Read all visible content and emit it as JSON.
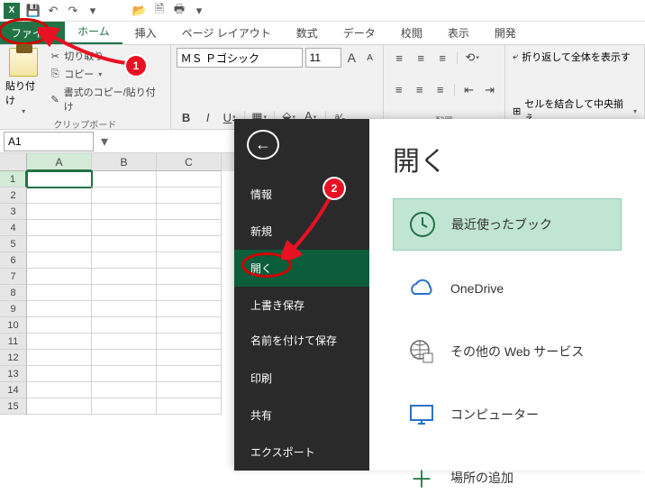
{
  "qat": {
    "undo": "↶",
    "redo": "↷"
  },
  "tabs": {
    "file": "ファイル",
    "home": "ホーム",
    "insert": "挿入",
    "pagelayout": "ページ レイアウト",
    "formulas": "数式",
    "data": "データ",
    "review": "校閲",
    "view": "表示",
    "developer": "開発"
  },
  "clipboard": {
    "paste": "貼り付け",
    "cut": "切り取り",
    "copy": "コピー",
    "format_painter": "書式のコピー/貼り付け",
    "group_label": "クリップボード"
  },
  "font": {
    "name": "ＭＳ Ｐゴシック",
    "size": "11",
    "bold": "B",
    "italic": "I",
    "underline": "U",
    "increase": "A",
    "decrease": "A"
  },
  "wrap": {
    "wrap_text": "折り返して全体を表示す",
    "merge": "セルを結合して中央揃え"
  },
  "align_group_label": "配置",
  "namebox": "A1",
  "columns": [
    "A",
    "B",
    "C"
  ],
  "rows": [
    "1",
    "2",
    "3",
    "4",
    "5",
    "6",
    "7",
    "8",
    "9",
    "10",
    "11",
    "12",
    "13",
    "14",
    "15"
  ],
  "backstage": {
    "title": "開く",
    "items": {
      "info": "情報",
      "new": "新規",
      "open": "開く",
      "save": "上書き保存",
      "saveas": "名前を付けて保存",
      "print": "印刷",
      "share": "共有",
      "export": "エクスポート"
    },
    "options": {
      "recent": "最近使ったブック",
      "onedrive": "OneDrive",
      "web": "その他の Web サービス",
      "computer": "コンピューター",
      "addplace": "場所の追加"
    }
  },
  "callouts": {
    "one": "1",
    "two": "2"
  }
}
